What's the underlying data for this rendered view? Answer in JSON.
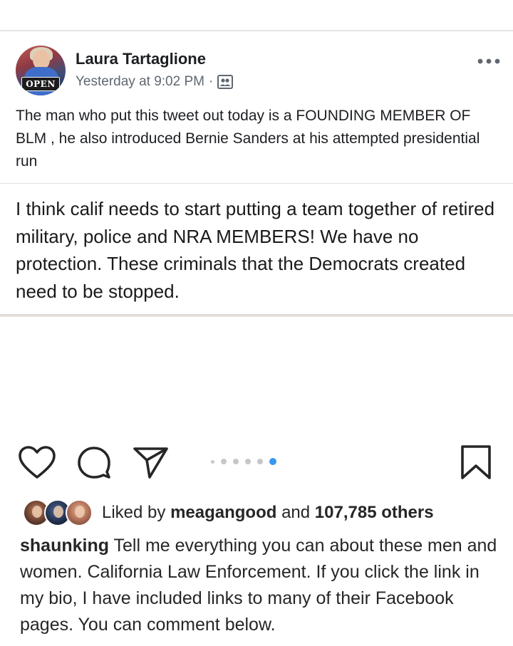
{
  "fb_post": {
    "author_name": "Laura Tartaglione",
    "timestamp": "Yesterday at 9:02 PM",
    "separator": "·",
    "audience_icon": "friends-icon",
    "more_icon": "more-options-icon",
    "avatar_sign_text": "OPEN",
    "caption": "The man who put this tweet out today is a FOUNDING MEMBER OF BLM , he also introduced Bernie Sanders at his attempted presidential run",
    "shared_text": "I think calif needs to start putting a team together of retired military, police and NRA MEMBERS! We have no protection. These criminals that the Democrats created need to be stopped."
  },
  "ig_post": {
    "actions": {
      "like_icon": "heart-icon",
      "comment_icon": "comment-icon",
      "share_icon": "send-icon",
      "save_icon": "bookmark-icon"
    },
    "carousel": {
      "total_visible_dots": 6,
      "active_index": 5
    },
    "likes": {
      "prefix": "Liked by",
      "user": "meagangood",
      "connector": "and",
      "count_text": "107,785 others"
    },
    "caption": {
      "username": "shaunking",
      "text": " Tell me everything you can about these men and women. California Law Enforcement. If you click the link in my bio, I have included links to many of their Facebook pages. You can comment below."
    },
    "colors": {
      "accent_blue": "#3897f0",
      "text_dark": "#262626",
      "inactive_dot": "#c7c7c7"
    }
  }
}
